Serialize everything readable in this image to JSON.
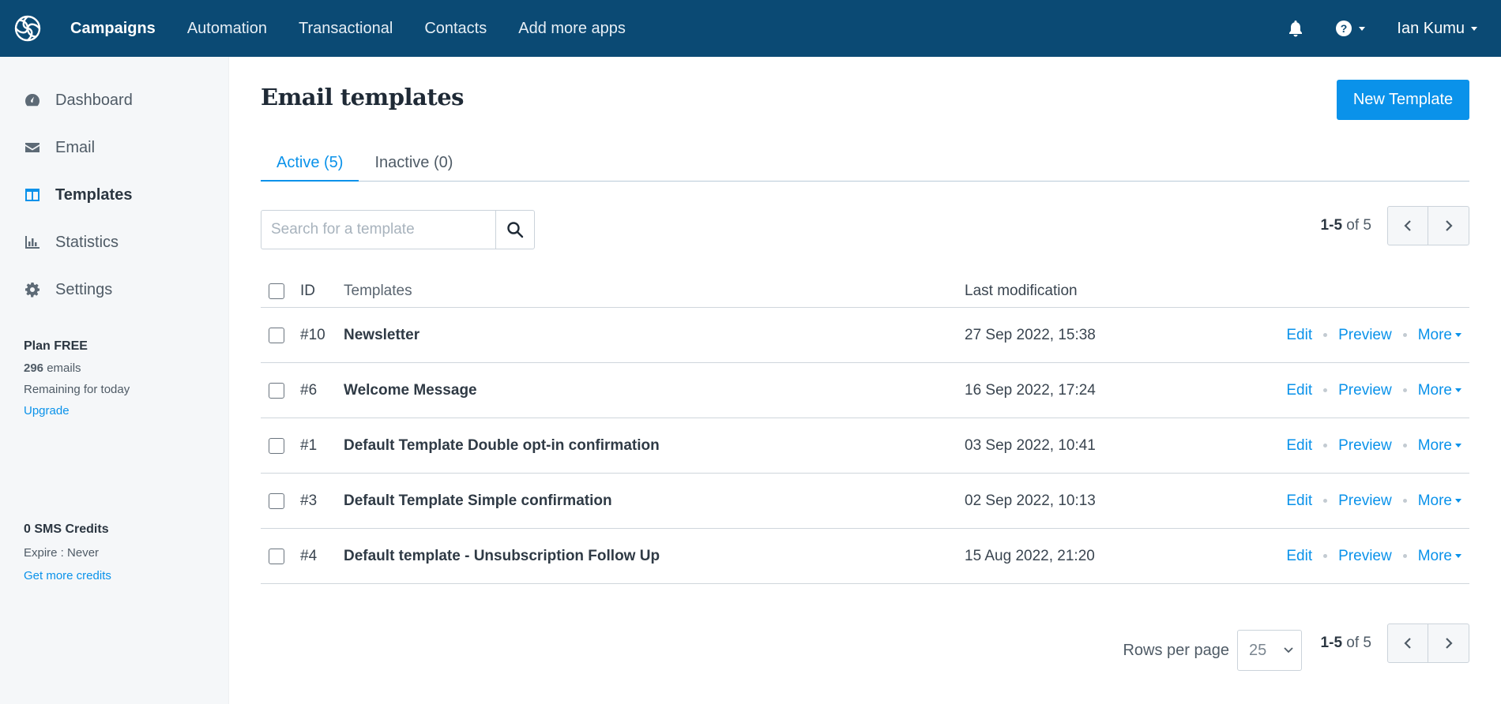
{
  "topbar": {
    "nav": [
      "Campaigns",
      "Automation",
      "Transactional",
      "Contacts",
      "Add more apps"
    ],
    "active_nav": "Campaigns",
    "user_name": "Ian Kumu",
    "bg_color": "#0b4a74"
  },
  "sidebar": {
    "items": [
      {
        "label": "Dashboard",
        "icon": "dashboard-icon"
      },
      {
        "label": "Email",
        "icon": "envelope-icon"
      },
      {
        "label": "Templates",
        "icon": "templates-icon"
      },
      {
        "label": "Statistics",
        "icon": "bar-chart-icon"
      },
      {
        "label": "Settings",
        "icon": "gear-icon"
      }
    ],
    "active_item": "Templates",
    "plan": {
      "title": "Plan FREE",
      "emails_count": "296",
      "emails_label": " emails",
      "remaining": "Remaining for today",
      "upgrade": "Upgrade"
    },
    "sms": {
      "title": "0 SMS Credits",
      "expire": "Expire : Never",
      "get_more": "Get more credits"
    }
  },
  "main": {
    "title": "Email templates",
    "new_button": "New Template",
    "tabs": [
      {
        "label": "Active (5)",
        "active": true
      },
      {
        "label": "Inactive (0)",
        "active": false
      }
    ],
    "search": {
      "placeholder": "Search for a template",
      "value": ""
    },
    "pager": {
      "range": "1-5",
      "of_label": " of 5"
    },
    "table": {
      "headers": {
        "id": "ID",
        "name": "Templates",
        "date": "Last modification"
      },
      "rows": [
        {
          "id": "#10",
          "name": "Newsletter",
          "date": "27 Sep 2022, 15:38"
        },
        {
          "id": "#6",
          "name": "Welcome Message",
          "date": "16 Sep 2022, 17:24"
        },
        {
          "id": "#1",
          "name": "Default Template Double opt-in confirmation",
          "date": "03 Sep 2022, 10:41"
        },
        {
          "id": "#3",
          "name": "Default Template Simple confirmation",
          "date": "02 Sep 2022, 10:13"
        },
        {
          "id": "#4",
          "name": "Default template - Unsubscription Follow Up",
          "date": "15 Aug 2022, 21:20"
        }
      ],
      "actions": {
        "edit": "Edit",
        "preview": "Preview",
        "more": "More"
      }
    },
    "rows_per_page": {
      "label": "Rows per page",
      "value": "25"
    },
    "accent_color": "#0a92ea"
  }
}
